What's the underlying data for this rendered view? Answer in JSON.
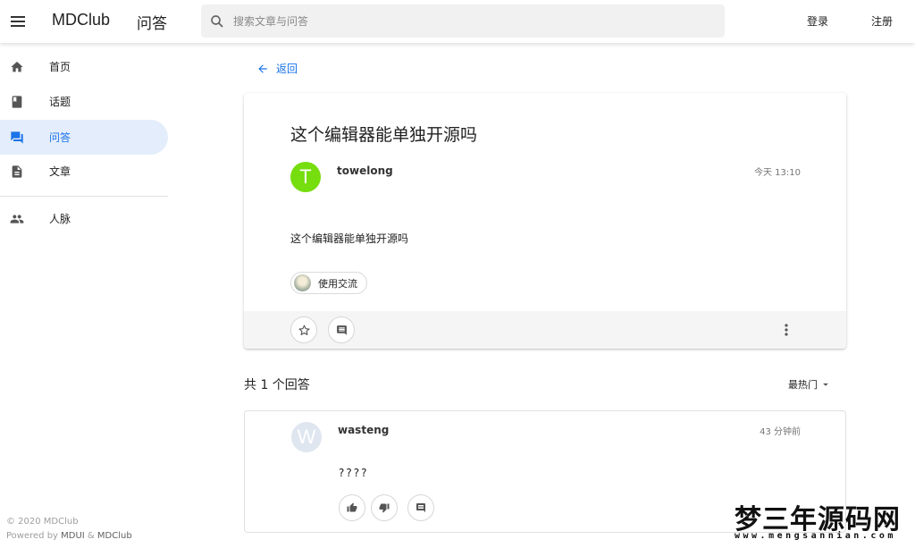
{
  "appbar": {
    "brand": "MDClub",
    "section": "问答",
    "search_placeholder": "搜索文章与问答",
    "login": "登录",
    "register": "注册"
  },
  "drawer": {
    "items": [
      {
        "label": "首页",
        "icon": "home-icon"
      },
      {
        "label": "话题",
        "icon": "book-icon"
      },
      {
        "label": "问答",
        "icon": "forum-icon",
        "active": true
      },
      {
        "label": "文章",
        "icon": "article-icon"
      },
      {
        "label": "人脉",
        "icon": "people-icon"
      }
    ],
    "copyright": "© 2020 MDClub",
    "powered_prefix": "Powered by ",
    "powered_mdui": "MDUI",
    "powered_amp": " & ",
    "powered_mdclub": "MDClub"
  },
  "back": {
    "label": "返回"
  },
  "question": {
    "title": "这个编辑器能单独开源吗",
    "author": "towelong",
    "avatar_letter": "T",
    "avatar_color": "#76dd0e",
    "time": "今天 13:10",
    "body": "这个编辑器能单独开源吗",
    "topic": "使用交流"
  },
  "answers": {
    "count_label": "共 1 个回答",
    "sort_label": "最热门",
    "items": [
      {
        "author": "wasteng",
        "avatar_letter": "W",
        "avatar_color": "#dfe6f0",
        "time": "43 分钟前",
        "body": "????"
      }
    ]
  },
  "watermark": {
    "main": "梦三年源码网",
    "sub": "www.mengsannian.com"
  },
  "colors": {
    "accent": "#1a73e8",
    "active_bg": "#e3edfb"
  }
}
